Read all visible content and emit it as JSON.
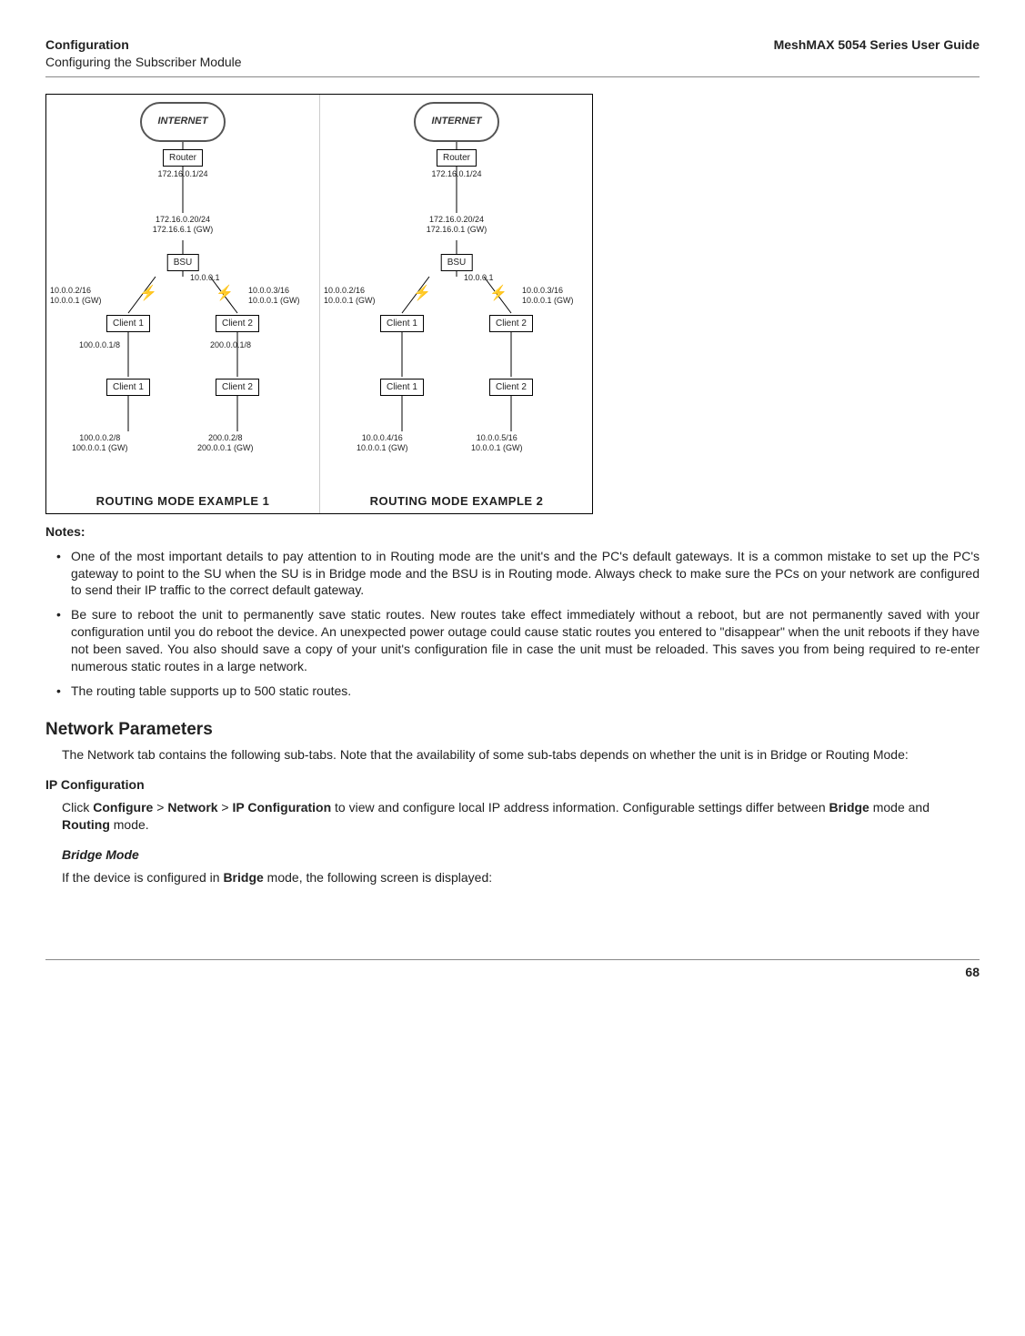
{
  "header": {
    "left_line1": "Configuration",
    "left_line2": "Configuring the Subscriber Module",
    "right": "MeshMAX 5054 Series User Guide"
  },
  "diagram": {
    "internet": "INTERNET",
    "router": "Router",
    "router_ip": "172.16.0.1/24",
    "bsu_upper1": "172.16.0.20/24",
    "bsu_upper2": "172.16.6.1 (GW)",
    "bsu_upper2_r": "172.16.0.1 (GW)",
    "bsu": "BSU",
    "bsu_ip": "10.0.0.1",
    "left_upper_l1": "10.0.0.2/16",
    "left_upper_l2": "10.0.0.1 (GW)",
    "right_upper_l1": "10.0.0.3/16",
    "right_upper_l2": "10.0.0.1 (GW)",
    "client1": "Client 1",
    "client2": "Client 2",
    "ex1": {
      "c1_mid": "100.0.0.1/8",
      "c2_mid": "200.0.0.1/8",
      "c1_low1": "100.0.0.2/8",
      "c1_low2": "100.0.0.1 (GW)",
      "c2_low1": "200.0.2/8",
      "c2_low2": "200.0.0.1 (GW)",
      "caption": "ROUTING MODE EXAMPLE 1"
    },
    "ex2": {
      "c1_low1": "10.0.0.4/16",
      "c1_low2": "10.0.0.1 (GW)",
      "c2_low1": "10.0.0.5/16",
      "c2_low2": "10.0.0.1 (GW)",
      "caption": "ROUTING MODE EXAMPLE 2"
    }
  },
  "notes_heading": "Notes:",
  "notes": {
    "n1": "One of the most important details to pay attention to in Routing mode are the unit's and the PC's default gateways. It is a common mistake to set up the PC's gateway to point to the SU when the SU is in Bridge mode and the BSU is in Routing mode. Always check to make sure the PCs on your network are configured to send their IP traffic to the correct default gateway.",
    "n2": "Be sure to reboot the unit to permanently save static routes. New routes take effect immediately without a reboot, but are not permanently saved with your configuration until you do reboot the device. An unexpected power outage could cause static routes you entered to \"disappear\" when the unit reboots if they have not been saved. You also should save a copy of your unit's configuration file in case the unit must be reloaded. This saves you from being required to re-enter numerous static routes in a large network.",
    "n3": "The routing table supports up to 500 static routes."
  },
  "section_heading": "Network Parameters",
  "section_intro": "The Network tab contains the following sub-tabs. Note that the availability of some sub-tabs depends on whether the unit is in Bridge or Routing Mode:",
  "ipconf_heading": "IP Configuration",
  "ipconf_text_pre": "Click ",
  "ipconf_b1": "Configure",
  "ipconf_gt1": " > ",
  "ipconf_b2": "Network",
  "ipconf_gt2": " > ",
  "ipconf_b3": "IP Configuration",
  "ipconf_text_mid": " to view and configure local IP address information. Configurable settings differ between ",
  "ipconf_b4": "Bridge",
  "ipconf_text_mid2": " mode and ",
  "ipconf_b5": "Routing",
  "ipconf_text_end": " mode.",
  "bridge_heading": "Bridge Mode",
  "bridge_text_pre": "If the device is configured in ",
  "bridge_b": "Bridge",
  "bridge_text_post": " mode, the following screen is displayed:",
  "page_number": "68"
}
